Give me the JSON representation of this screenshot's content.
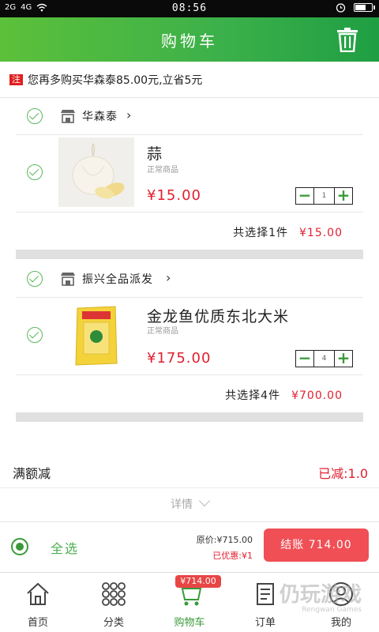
{
  "status_bar": {
    "signal_left": "2G",
    "signal_right": "4G",
    "time": "08:56"
  },
  "header": {
    "title": "购物车"
  },
  "promo": {
    "tag": "注",
    "text": "您再多购买华森泰85.00元,立省5元"
  },
  "shops": [
    {
      "name": "华森泰",
      "items": [
        {
          "name": "蒜",
          "subtitle": "正常商品",
          "price": "¥15.00",
          "quantity": "1"
        }
      ],
      "subtotal_label": "共选择1件",
      "subtotal_amount": "¥15.00"
    },
    {
      "name": "振兴全品派发",
      "items": [
        {
          "name": "金龙鱼优质东北大米",
          "subtitle": "正常商品",
          "price": "¥175.00",
          "quantity": "4"
        }
      ],
      "subtotal_label": "共选择4件",
      "subtotal_amount": "¥700.00"
    }
  ],
  "full_cut": {
    "label": "满额减",
    "value": "已减:1.0"
  },
  "details": {
    "label": "详情"
  },
  "checkout": {
    "select_all": "全选",
    "original_price": "原价:¥715.00",
    "discount": "已优惠:¥1",
    "pay_button": "结账 714.00"
  },
  "tabbar": {
    "tabs": [
      {
        "label": "首页",
        "icon": "home-icon"
      },
      {
        "label": "分类",
        "icon": "grid-icon"
      },
      {
        "label": "购物车",
        "icon": "cart-icon",
        "active": true
      },
      {
        "label": "订单",
        "icon": "order-icon"
      },
      {
        "label": "我的",
        "icon": "profile-icon"
      }
    ],
    "cart_badge": "¥714.00"
  },
  "watermark": {
    "text": "仍玩游戏",
    "sub": "Rengwan Games"
  },
  "colors": {
    "header_green": "#3bb04a",
    "price_red": "#e02030",
    "pay_button": "#ef4f55",
    "active_tab": "#3a9a3a"
  }
}
